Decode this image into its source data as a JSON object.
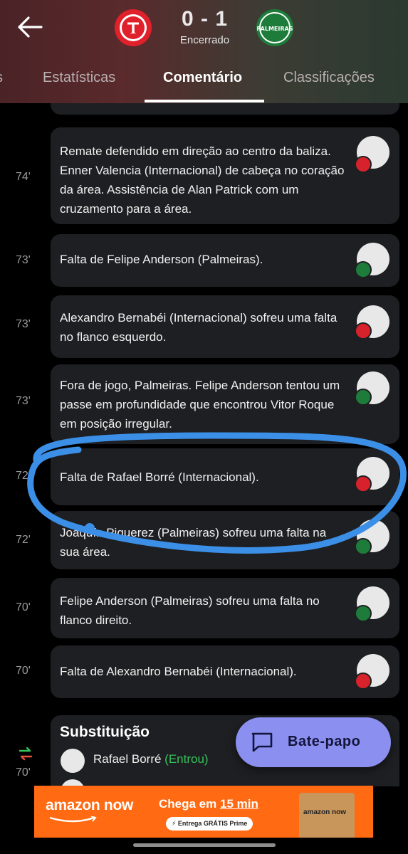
{
  "header": {
    "score_home": "0",
    "score_sep": "-",
    "score_away": "1",
    "status": "Encerrado",
    "home_team_crest": "internacional-crest",
    "away_team_crest": "palmeiras-crest",
    "away_crest_text": "PALMEIRAS"
  },
  "tabs": [
    {
      "label": "s"
    },
    {
      "label": "Estatísticas"
    },
    {
      "label": "Comentário",
      "active": true
    },
    {
      "label": "Classificações"
    }
  ],
  "feed": [
    {
      "minute": "74'",
      "text": "Remate defendido em direção ao centro da baliza. Enner Valencia (Internacional) de cabeça no coração da área. Assistência de Alan Patrick com um cruzamento para a área.",
      "team": "inter"
    },
    {
      "minute": "73'",
      "text": "Falta de Felipe Anderson (Palmeiras).",
      "team": "palmeiras"
    },
    {
      "minute": "73'",
      "text": "Alexandro Bernabéi (Internacional) sofreu uma falta no flanco esquerdo.",
      "team": "inter"
    },
    {
      "minute": "73'",
      "text": "Fora de jogo, Palmeiras. Felipe Anderson tentou um passe em profundidade que encontrou Vitor Roque em posição irregular.",
      "team": "palmeiras"
    },
    {
      "minute": "72'",
      "text": "Falta de Rafael Borré (Internacional).",
      "team": "inter"
    },
    {
      "minute": "72'",
      "text": "Joaquín Piquerez (Palmeiras) sofreu uma falta na sua área.",
      "team": "palmeiras"
    },
    {
      "minute": "70'",
      "text": "Felipe Anderson (Palmeiras) sofreu uma falta no flanco direito.",
      "team": "palmeiras"
    },
    {
      "minute": "70'",
      "text": "Falta de Alexandro Bernabéi (Internacional).",
      "team": "inter"
    }
  ],
  "substitution": {
    "minute": "70'",
    "title": "Substituição",
    "player_in": "Rafael Borré",
    "entered_label": "(Entrou)"
  },
  "chat_button": {
    "label": "Bate-papo"
  },
  "ad": {
    "brand": "amazon now",
    "headline_pre": "Chega em ",
    "headline_em": "15 min",
    "pill": "⚡ Entrega GRÁTIS Prime",
    "bag_text": "amazon now"
  },
  "colors": {
    "accent_green": "#35c35c",
    "chat_bg": "#8a8ff0",
    "ad_bg": "#ff6a13",
    "annotation_blue": "#3b8fe6",
    "inter_red": "#d7222b",
    "palmeiras_green": "#1e7c3a"
  }
}
